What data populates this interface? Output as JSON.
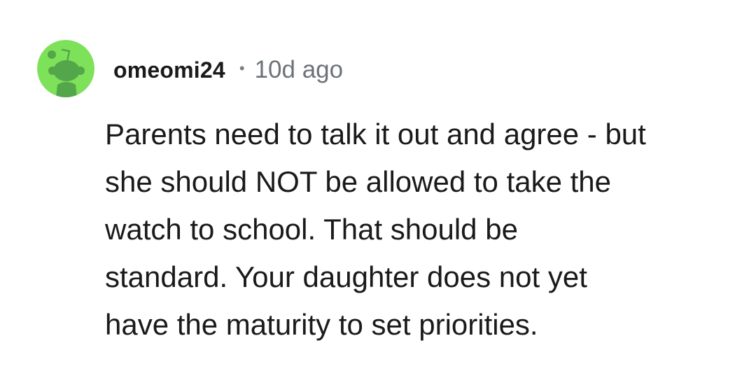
{
  "comment": {
    "author": {
      "username": "omeomi24",
      "avatar_icon": "snoo-avatar-icon",
      "avatar_color": "#7ee15a"
    },
    "separator": "•",
    "timestamp": "10d ago",
    "body": "Parents need to talk it out and agree - but\nshe should NOT be allowed to take the\nwatch to school. That should be\nstandard. Your daughter does not yet\nhave the maturity to set priorities."
  }
}
